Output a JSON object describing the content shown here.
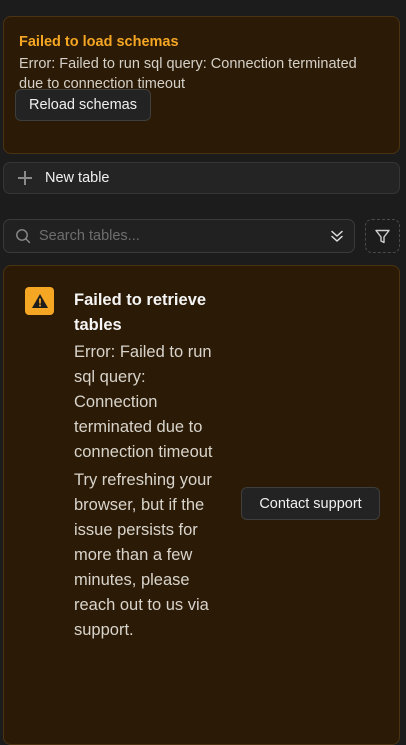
{
  "schema_alert": {
    "title": "Failed to load schemas",
    "message": "Error: Failed to run sql query: Connection terminated due to connection timeout",
    "reload_label": "Reload schemas"
  },
  "new_table": {
    "label": "New table",
    "icon": "plus-icon"
  },
  "search": {
    "placeholder": "Search tables...",
    "icon": "search-icon",
    "sort_icon": "chevrons-icon"
  },
  "filter": {
    "icon": "filter-icon"
  },
  "tables_alert": {
    "icon": "warning-icon",
    "title": "Failed to retrieve tables",
    "message": "Error: Failed to run sql query: Connection terminated due to connection timeout",
    "hint": "Try refreshing your browser, but if the issue persists for more than a few minutes, please reach out to us via support.",
    "contact_label": "Contact support"
  },
  "colors": {
    "background": "#1c1c1c",
    "warning_bg": "#2b1a05",
    "warning_accent": "#f5a623"
  }
}
